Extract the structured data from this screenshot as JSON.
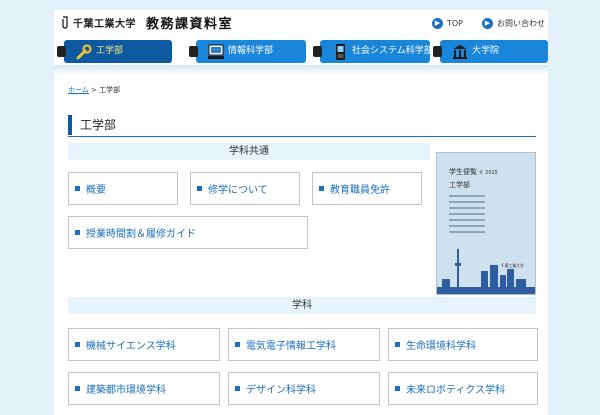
{
  "header": {
    "university": "千葉工業大学",
    "office": "教務課資料室",
    "links": [
      {
        "label": "TOP",
        "icon": "arrow-right-icon"
      },
      {
        "label": "お問い合わせ",
        "icon": "arrow-right-icon"
      }
    ]
  },
  "nav": {
    "tabs": [
      {
        "label": "工学部",
        "icon": "wrench-icon",
        "active": true
      },
      {
        "label": "情報科学部",
        "icon": "computer-icon",
        "active": false
      },
      {
        "label": "社会システム科学部",
        "icon": "mobile-phone-icon",
        "active": false
      },
      {
        "label": "大学院",
        "icon": "building-icon",
        "active": false
      }
    ]
  },
  "breadcrumb": {
    "home": "ホーム",
    "separator": ">",
    "current": "工学部"
  },
  "page_title": "工学部",
  "common": {
    "heading": "学科共通",
    "links": [
      "概要",
      "修学について",
      "教育職員免許",
      "授業時間割＆履修ガイド"
    ]
  },
  "handbook": {
    "title": "学生便覧",
    "year": "2015",
    "subtitle": "工学部"
  },
  "departments": {
    "heading": "学科",
    "links": [
      "機械サイエンス学科",
      "電気電子情報工学科",
      "生命環境科学科",
      "建築都市環境学科",
      "デザイン科学科",
      "未来ロボティクス学科"
    ]
  },
  "colors": {
    "accent": "#1a6fbf",
    "nav": "#1a86d9",
    "nav_active": "#0d5aa0",
    "background": "#e4f1f9"
  }
}
